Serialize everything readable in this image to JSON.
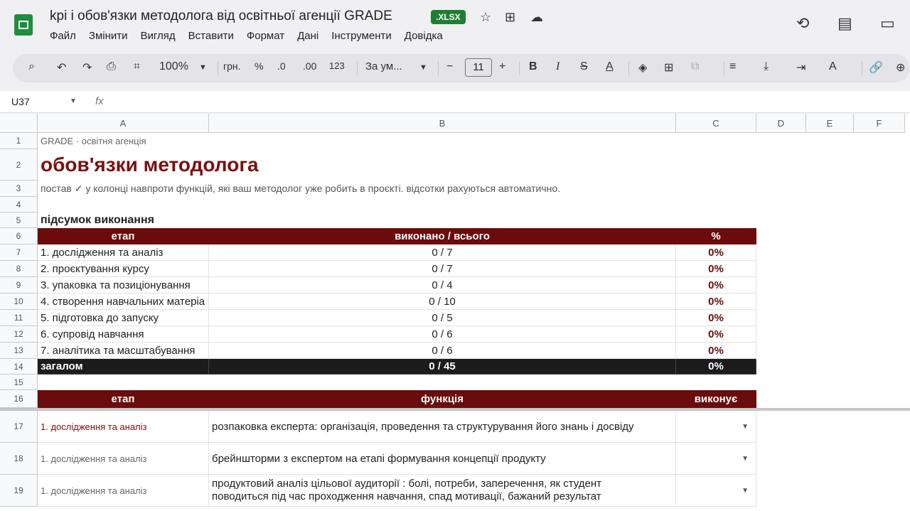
{
  "doc": {
    "title": "kpi і обов'язки методолога від освітньої агенції GRADE",
    "badge": ".XLSX"
  },
  "menu": [
    "Файл",
    "Змінити",
    "Вигляд",
    "Вставити",
    "Формат",
    "Дані",
    "Інструменти",
    "Довідка"
  ],
  "toolbar": {
    "zoom": "100%",
    "currency": "грн.",
    "percent": "%",
    "dec_less": ".0",
    "dec_more": ".00",
    "numfmt": "123",
    "font": "За ум...",
    "font_size": "11"
  },
  "formula": {
    "namebox": "U37",
    "fx": "fx"
  },
  "columns": [
    "A",
    "B",
    "C",
    "D",
    "E",
    "F"
  ],
  "rows": [
    "1",
    "2",
    "3",
    "4",
    "5",
    "6",
    "7",
    "8",
    "9",
    "10",
    "11",
    "12",
    "13",
    "14",
    "15",
    "16",
    "17",
    "18",
    "19"
  ],
  "sheet": {
    "r1": "GRADE · освітня агенція",
    "r2": "обов'язки методолога",
    "r3": "постав ✓ у колонці навпроти функцій, які ваш методолог уже робить в проєкті. відсотки рахуються автоматично.",
    "r5": "підсумок виконання",
    "summary_header": [
      "етап",
      "виконано / всього",
      "%"
    ],
    "summary": [
      [
        "1. дослідження та аналіз",
        "0 / 7",
        "0%"
      ],
      [
        "2. проєктування курсу",
        "0 / 7",
        "0%"
      ],
      [
        "3. упаковка та позиціонування",
        "0 / 4",
        "0%"
      ],
      [
        "4. створення навчальних матеріа",
        "0 / 10",
        "0%"
      ],
      [
        "5. підготовка до запуску",
        "0 / 5",
        "0%"
      ],
      [
        "6. супровід навчання",
        "0 / 6",
        "0%"
      ],
      [
        "7. аналітика та масштабування",
        "0 / 6",
        "0%"
      ]
    ],
    "total": [
      "загалом",
      "0 / 45",
      "0%"
    ],
    "func_header": [
      "етап",
      "функція",
      "виконує"
    ],
    "functions": [
      [
        "1. дослідження та аналіз",
        "розпаковка експерта: організація, проведення та структурування його знань і досвіду"
      ],
      [
        "1. дослідження та аналіз",
        "брейншторми з експертом на етапі формування концепції продукту"
      ],
      [
        "1. дослідження та аналіз",
        "продуктовий аналіз цільової аудиторії : болі, потреби, заперечення, як студент",
        "поводиться під час проходження навчання, спад мотивації, бажаний результат"
      ]
    ]
  }
}
